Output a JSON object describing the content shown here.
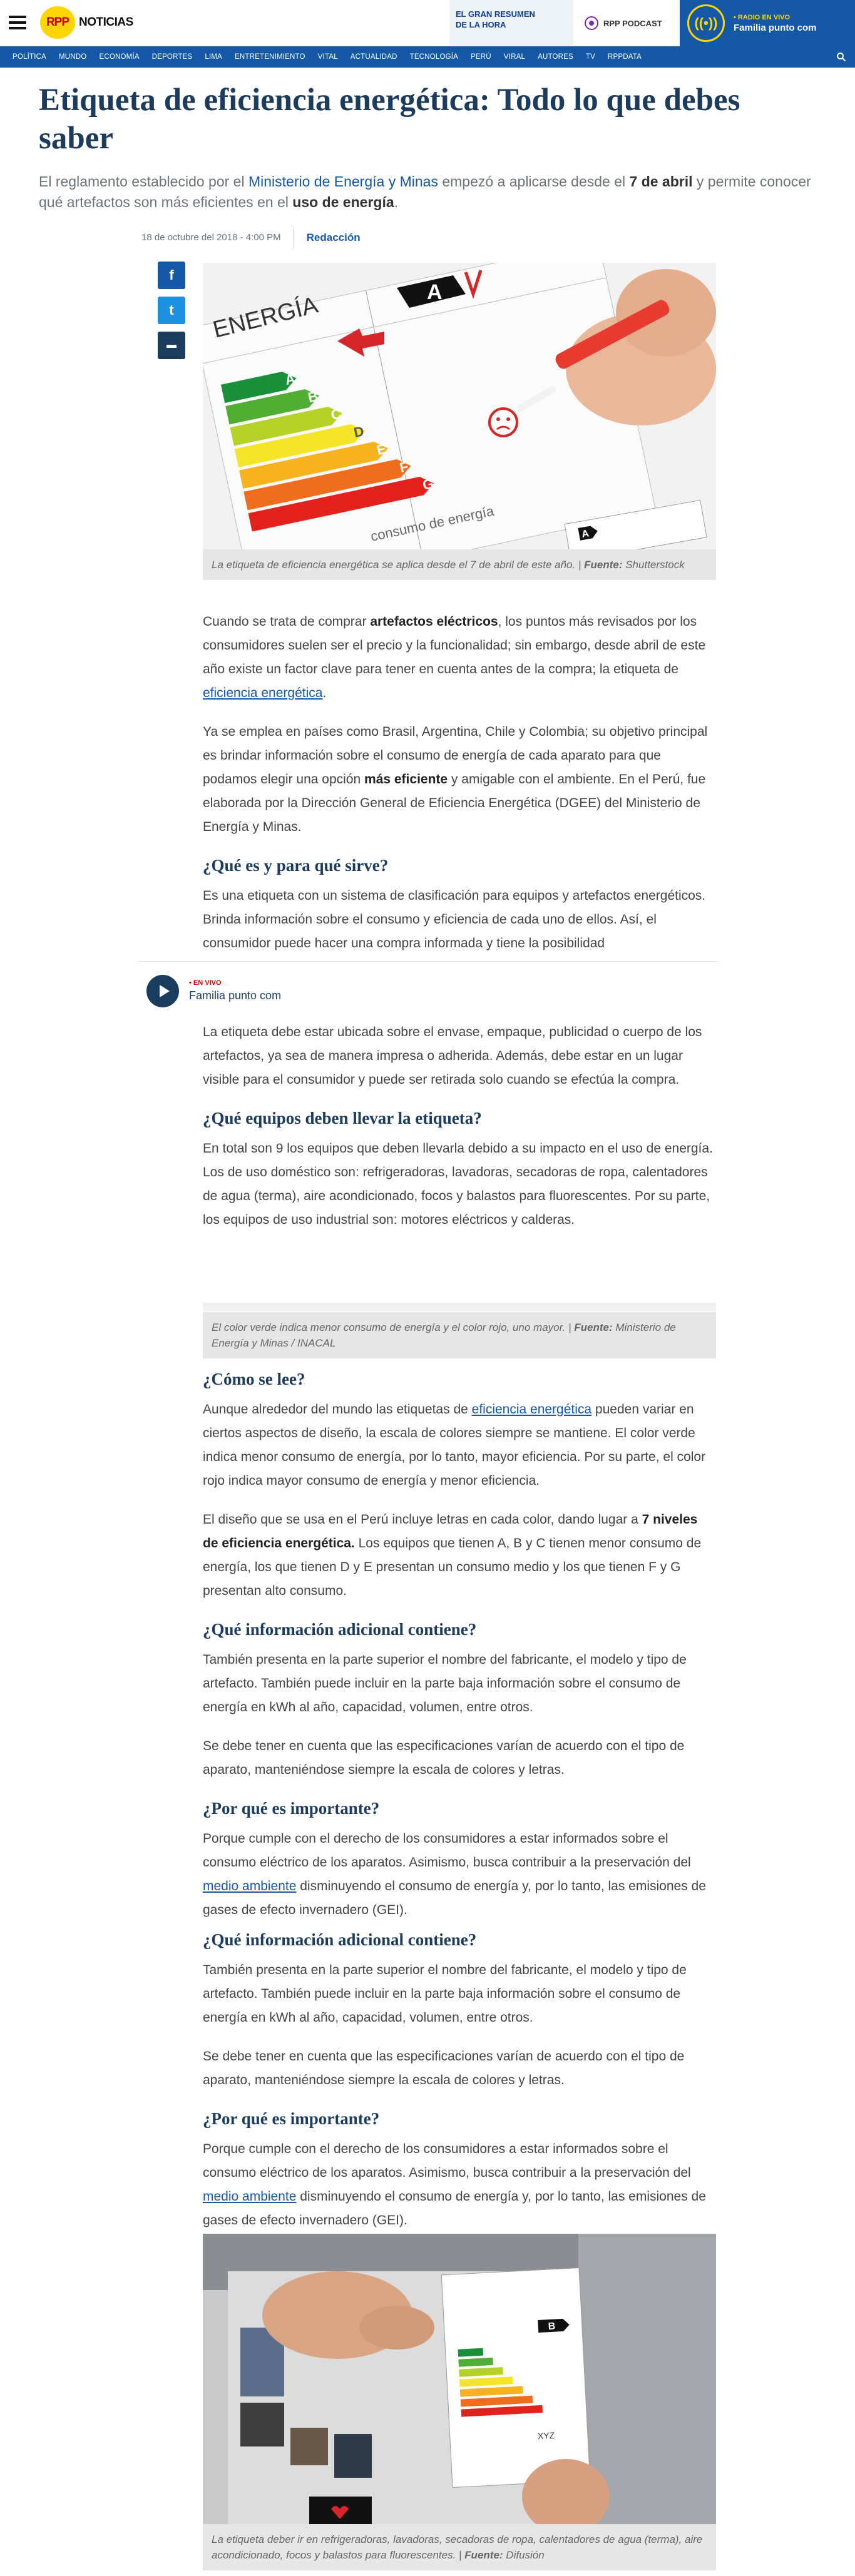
{
  "header": {
    "logo_badge": "RPP",
    "logo_text": "NOTICIAS",
    "promo_line1": "EL GRAN RESUMEN",
    "promo_line2": "DE LA HORA",
    "podcast_label": "RPP PODCAST",
    "live_line1": "• RADIO EN VIVO",
    "live_line2": "Familia punto com"
  },
  "nav": {
    "items": [
      "POLÍTICA",
      "MUNDO",
      "ECONOMÍA",
      "DEPORTES",
      "LIMA",
      "ENTRETENIMIENTO",
      "VITAL",
      "ACTUALIDAD",
      "TECNOLOGÍA",
      "PERÚ",
      "VIRAL",
      "AUTORES",
      "TV",
      "RPPDATA"
    ]
  },
  "article": {
    "headline": "Etiqueta de eficiencia energética: Todo lo que debes saber",
    "subtitle_1": "El reglamento establecido por el ",
    "subtitle_link": "Ministerio de Energía y Minas",
    "subtitle_2": " empezó a aplicarse desde el ",
    "subtitle_bold1": "7 de abril",
    "subtitle_3": " y permite conocer qué artefactos son más eficientes en el ",
    "subtitle_bold2": "uso de energía",
    "subtitle_4": ".",
    "date": "18 de octubre del 2018 - 4:00 PM",
    "author": "Redacción"
  },
  "figures": {
    "fig1_caption": "La etiqueta de eficiencia energética se aplica desde el 7 de abril de este año. | ",
    "fig1_source_label": "Fuente:",
    "fig1_source": " Shutterstock",
    "fig2_caption": "El color verde indica menor consumo de energía y el color rojo, uno mayor. | ",
    "fig2_source_label": "Fuente:",
    "fig2_source": " Ministerio de Energía y Minas / INACAL",
    "fig3_caption": "La etiqueta deber ir en refrigeradoras, lavadoras, secadoras de ropa, calentadores de agua (terma), aire acondicionado, focos y balastos para fluorescentes. | ",
    "fig3_source_label": "Fuente:",
    "fig3_source": " Difusión"
  },
  "image1": {
    "energia_label": "ENERGÍA",
    "arrow_letters": [
      "A",
      "B",
      "C",
      "D",
      "E",
      "F",
      "G"
    ],
    "big_a": "A",
    "side_letter": "A",
    "bottom_text": "consumo de energía"
  },
  "image3": {
    "label_letter": "B",
    "xyz_text": "XYZ"
  },
  "body": {
    "p1_a": "Cuando se trata de comprar ",
    "p1_b": "artefactos eléctricos",
    "p1_c": ", los puntos más revisados por los consumidores suelen ser el precio y la funcionalidad; sin embargo, desde abril de este año existe un factor clave para tener en cuenta antes de la compra; la etiqueta de ",
    "p1_link": "eficiencia energética",
    "p1_d": ".",
    "p2_a": "Ya se emplea en países como Brasil, Argentina, Chile y Colombia; su objetivo principal es brindar información sobre el consumo de energía de cada aparato para que podamos elegir una opción ",
    "p2_b": "más eficiente",
    "p2_c": " y amigable con el ambiente. En el Perú, fue elaborada por la Dirección General de Eficiencia Energética (DGEE) del Ministerio de Energía y Minas.",
    "h_que_es": "¿Qué es y para qué sirve?",
    "p3": "Es una etiqueta con un sistema de clasificación para equipos y artefactos energéticos. Brinda información sobre el consumo y eficiencia de cada uno de ellos. Así, el consumidor puede hacer una compra informada y tiene la posibilidad",
    "p4": "La etiqueta debe estar ubicada sobre el envase, empaque, publicidad o cuerpo de los artefactos, ya sea de manera impresa o adherida. Además, debe estar en un lugar visible para el consumidor y puede ser retirada solo cuando se efectúa la compra.",
    "h_equipos": "¿Qué equipos deben llevar la etiqueta?",
    "p5": "En total son 9 los equipos que deben llevarla debido a su impacto en el uso de energía. Los de uso doméstico son: refrigeradoras, lavadoras, secadoras de ropa, calentadores de agua (terma), aire acondicionado, focos y balastos para fluorescentes. Por su parte, los equipos de uso industrial son: motores eléctricos y calderas.",
    "h_como": "¿Cómo se lee?",
    "p6_a": "Aunque alrededor del mundo las etiquetas de ",
    "p6_link": "eficiencia energética",
    "p6_b": " pueden variar en ciertos aspectos de diseño, la escala de colores siempre se mantiene. El color verde indica menor consumo de energía, por lo tanto, mayor eficiencia. Por su parte, el color rojo indica mayor consumo de energía y menor eficiencia.",
    "p7_a": "El diseño que se usa en el Perú incluye letras en cada color, dando lugar a ",
    "p7_b": "7 niveles de eficiencia energética.",
    "p7_c": "  Los equipos que tienen A, B y C tienen menor consumo de energía, los que tienen D y E presentan un consumo medio y los que tienen F y G presentan alto consumo.",
    "h_info": "¿Qué información adicional contiene?",
    "p8": "También presenta en la parte superior el nombre del fabricante, el modelo y tipo de artefacto. También puede incluir en la parte baja información sobre el consumo de energía en kWh al año, capacidad, volumen, entre otros.",
    "p9": "Se debe tener en cuenta que las especificaciones varían de acuerdo con el tipo de aparato, manteniéndose siempre la escala de colores y letras.",
    "h_importante": "¿Por qué es importante?",
    "p10_a": "Porque cumple con el derecho de los consumidores a estar informados sobre el consumo eléctrico de los aparatos. Asimismo, busca contribuir a la preservación del ",
    "p10_link": "medio ambiente",
    "p10_b": " disminuyendo el consumo de energía y, por lo tanto, las emisiones de gases de efecto invernadero (GEI)."
  },
  "player": {
    "live_label": "• EN VIVO",
    "title": "Familia punto com"
  },
  "social": {
    "fb": "f",
    "tw": "t",
    "cm": "▬"
  },
  "colors": {
    "brand_blue": "#1458a6",
    "headline": "#1c3c5e",
    "logo_yellow": "#ffd600",
    "logo_red": "#c4001a"
  }
}
